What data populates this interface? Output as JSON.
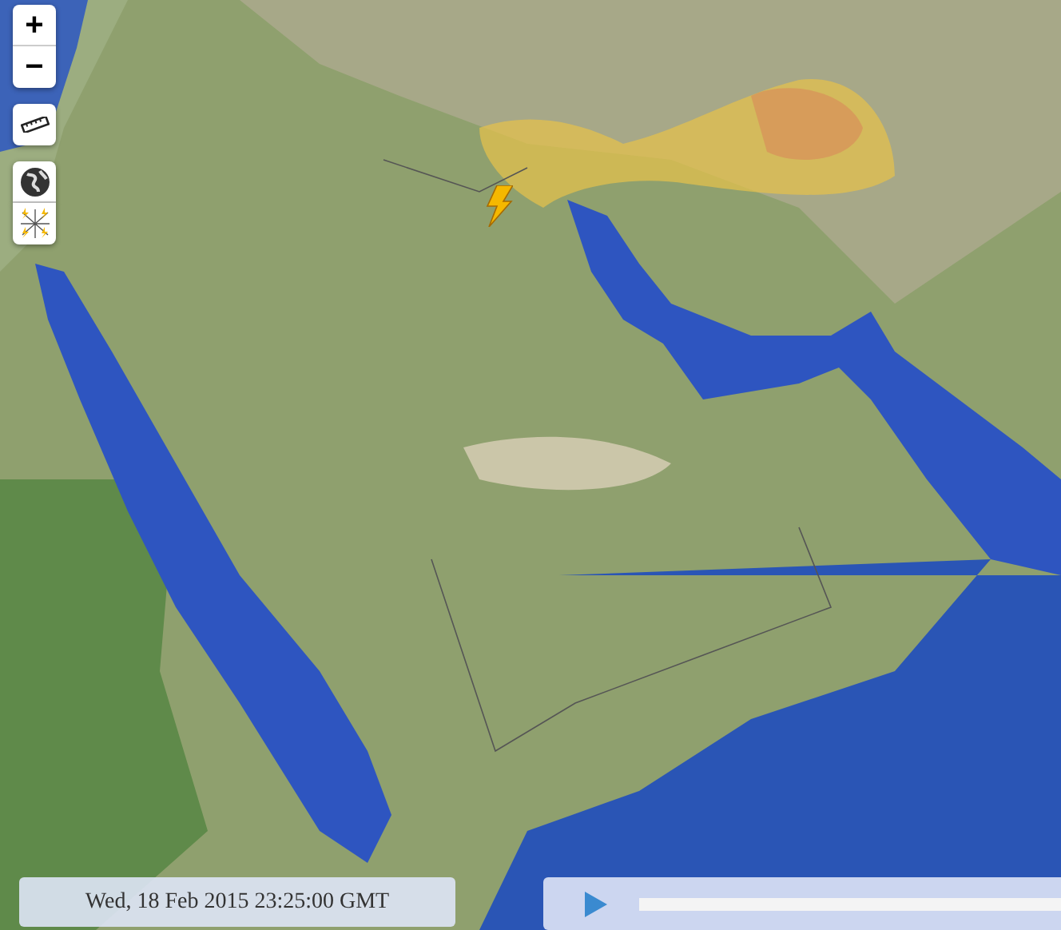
{
  "zoom_controls": {
    "zoom_in": "+",
    "zoom_out": "−"
  },
  "layer_buttons": [
    {
      "kind": "ruler"
    },
    {
      "kind": "globe"
    },
    {
      "kind": "lightning"
    }
  ],
  "timeline": {
    "timestamp": "Wed, 18 Feb 2015 23:25:00 GMT"
  }
}
